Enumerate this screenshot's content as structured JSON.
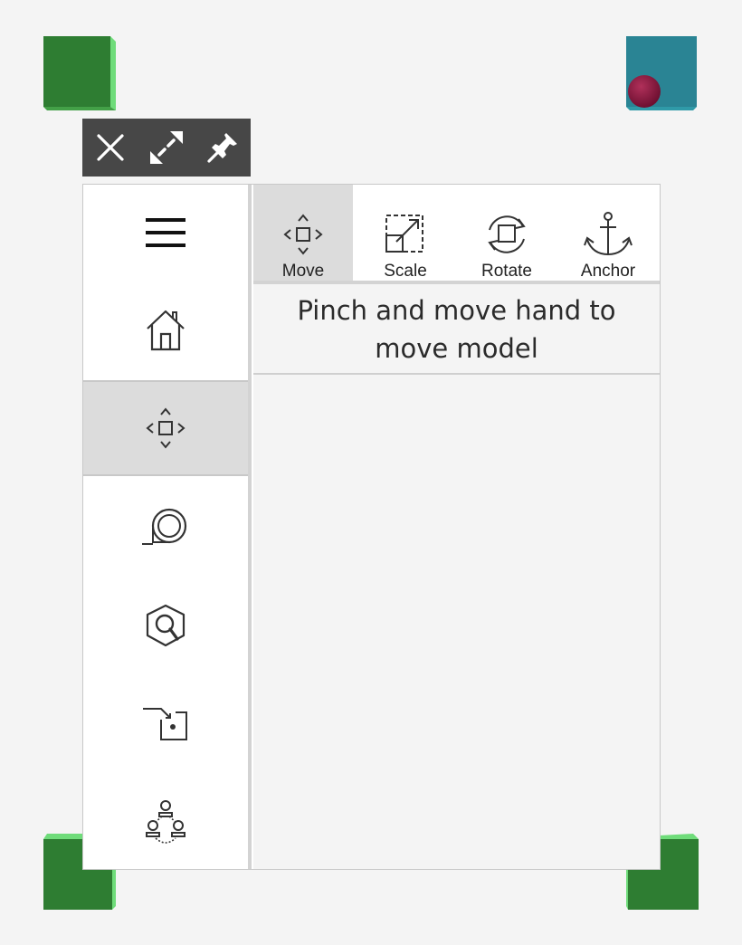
{
  "window": {
    "toolbar": {
      "close_icon": "close-icon",
      "resize_icon": "resize-diagonal-icon",
      "pin_icon": "pin-icon"
    }
  },
  "sidebar": {
    "items": [
      {
        "icon": "hamburger-menu-icon",
        "active": false
      },
      {
        "icon": "home-icon",
        "active": false
      },
      {
        "icon": "move-icon",
        "active": true
      },
      {
        "icon": "tape-measure-icon",
        "active": false
      },
      {
        "icon": "inspect-cube-icon",
        "active": false
      },
      {
        "icon": "place-into-box-icon",
        "active": false
      },
      {
        "icon": "network-nodes-icon",
        "active": false
      }
    ]
  },
  "tabs": [
    {
      "label": "Move",
      "icon": "move-icon",
      "active": true
    },
    {
      "label": "Scale",
      "icon": "scale-icon",
      "active": false
    },
    {
      "label": "Rotate",
      "icon": "rotate-icon",
      "active": false
    },
    {
      "label": "Anchor",
      "icon": "anchor-icon",
      "active": false
    }
  ],
  "instruction": "Pinch and move hand to move model",
  "colors": {
    "cube_green": "#2e7d32",
    "cube_edge_light": "#6fdc7a",
    "cube_teal": "#2a8494",
    "sphere": "#8a1a3f",
    "toolbar_bg": "#474747",
    "active_bg": "#dcdcdc"
  }
}
